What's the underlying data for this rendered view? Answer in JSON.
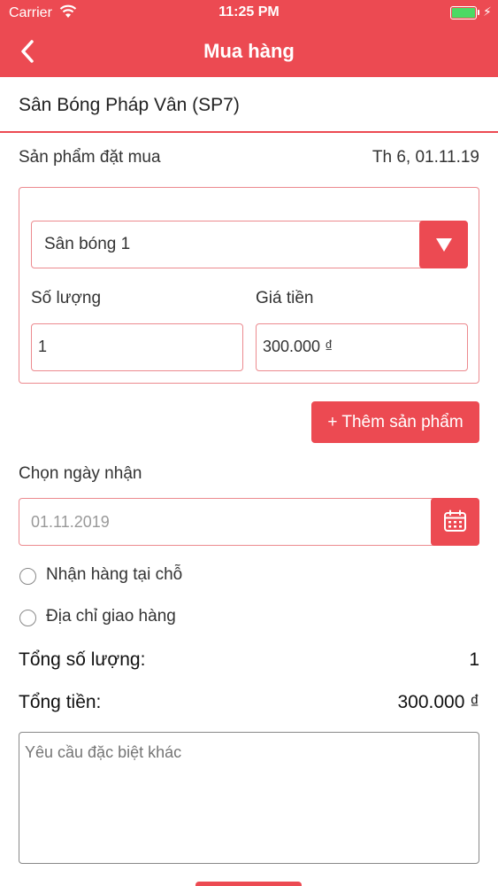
{
  "status_bar": {
    "carrier": "Carrier",
    "time": "11:25 PM",
    "battery_color": "#4cd964"
  },
  "nav": {
    "title": "Mua hàng",
    "back_icon": "chevron-left-icon"
  },
  "venue": {
    "name": "Sân Bóng Pháp Vân (SP7)"
  },
  "order": {
    "section_label": "Sản phẩm đặt mua",
    "date": "Th 6, 01.11.19",
    "product": {
      "selected": "Sân bóng 1",
      "quantity_label": "Số lượng",
      "quantity_value": "1",
      "price_label": "Giá tiền",
      "price_value": "300.000 ₫"
    },
    "add_button": "+ Thêm sản phẩm"
  },
  "delivery": {
    "date_label": "Chọn ngày nhận",
    "date_placeholder": "01.11.2019",
    "option_pickup": "Nhận hàng tại chỗ",
    "option_address": "Địa chỉ giao hàng"
  },
  "totals": {
    "qty_label": "Tổng số lượng:",
    "qty_value": "1",
    "money_label": "Tổng tiền:",
    "money_value": "300.000 ₫"
  },
  "notes": {
    "placeholder": "Yêu cầu đặc biệt khác"
  },
  "colors": {
    "accent": "#ec4a52"
  }
}
